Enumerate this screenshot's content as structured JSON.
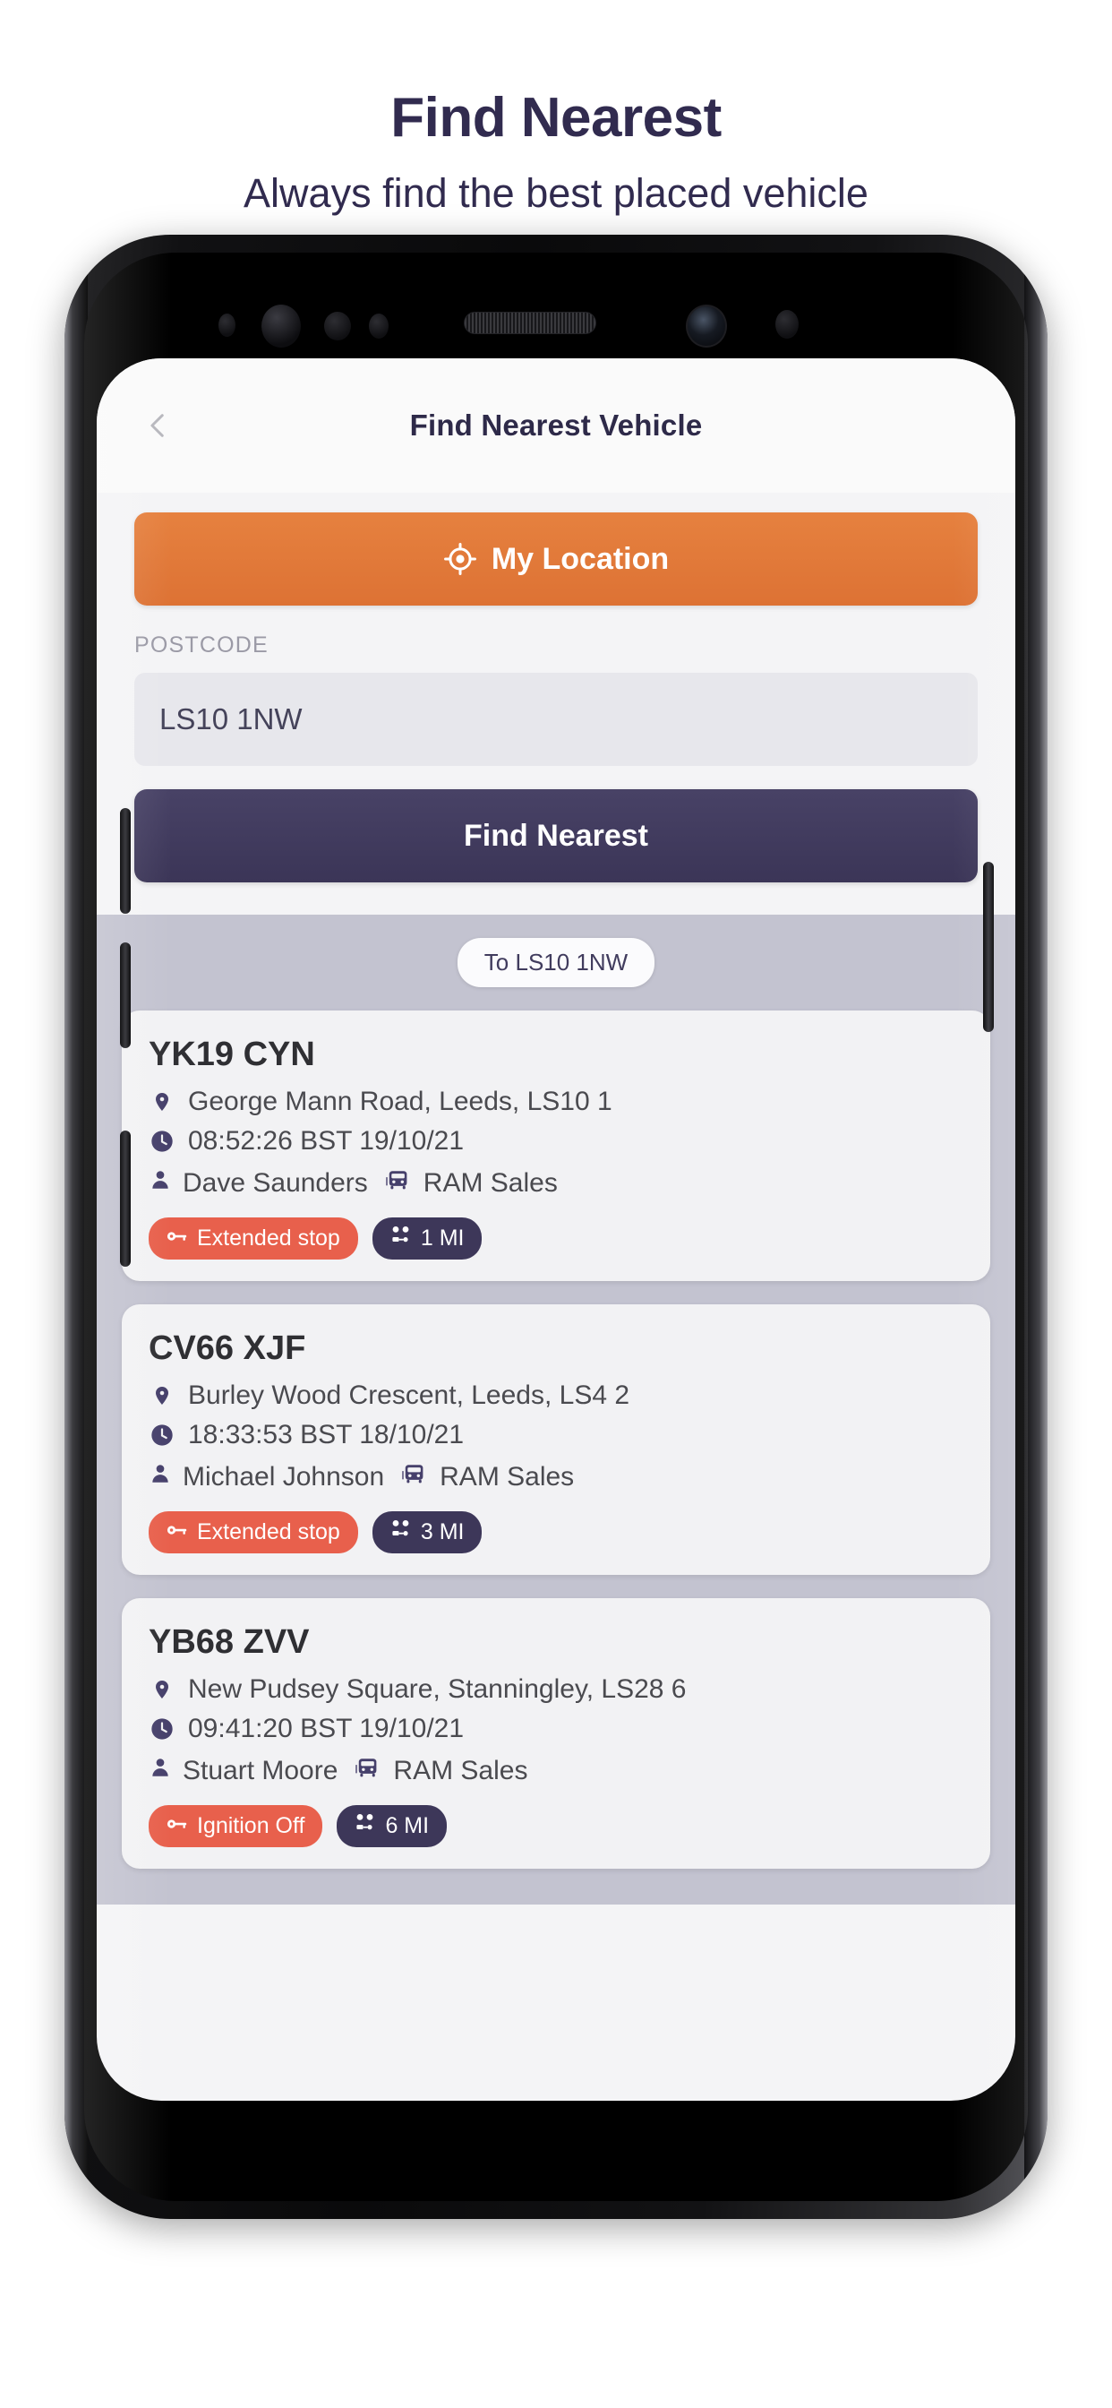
{
  "promo": {
    "title": "Find Nearest",
    "subtitle": "Always find the best placed vehicle"
  },
  "colors": {
    "brand_navy": "#3d3759",
    "brand_orange": "#e0763a",
    "status_red": "#e8604c",
    "screen_bg": "#f4f4f6",
    "results_bg": "#c3c3d0",
    "card_bg": "#f2f2f4"
  },
  "app": {
    "header": {
      "title": "Find Nearest Vehicle",
      "back_icon": "chevron-left-icon"
    },
    "search": {
      "my_location_label": "My Location",
      "my_location_icon": "crosshair-icon",
      "postcode_label": "POSTCODE",
      "postcode_value": "LS10 1NW",
      "postcode_placeholder": "LS10 1NW",
      "find_label": "Find Nearest"
    },
    "results": {
      "to_chip": "To LS10 1NW",
      "cards": [
        {
          "reg": "YK19 CYN",
          "location_icon": "map-pin-icon",
          "location": "George Mann Road, Leeds, LS10 1",
          "time_icon": "clock-icon",
          "time": "08:52:26 BST 19/10/21",
          "driver_icon": "person-icon",
          "driver": "Dave Saunders",
          "vehicle_icon": "car-icon",
          "fleet": "RAM Sales",
          "status_icon": "key-icon",
          "status": "Extended stop",
          "distance_icon": "route-icon",
          "distance": "1 MI"
        },
        {
          "reg": "CV66 XJF",
          "location_icon": "map-pin-icon",
          "location": "Burley Wood Crescent, Leeds, LS4 2",
          "time_icon": "clock-icon",
          "time": "18:33:53 BST 18/10/21",
          "driver_icon": "person-icon",
          "driver": "Michael Johnson",
          "vehicle_icon": "car-icon",
          "fleet": "RAM Sales",
          "status_icon": "key-icon",
          "status": "Extended stop",
          "distance_icon": "route-icon",
          "distance": "3 MI"
        },
        {
          "reg": "YB68 ZVV",
          "location_icon": "map-pin-icon",
          "location": "New Pudsey Square, Stanningley, LS28 6",
          "time_icon": "clock-icon",
          "time": "09:41:20 BST 19/10/21",
          "driver_icon": "person-icon",
          "driver": "Stuart Moore",
          "vehicle_icon": "car-icon",
          "fleet": "RAM Sales",
          "status_icon": "key-icon",
          "status": "Ignition Off",
          "distance_icon": "route-icon",
          "distance": "6 MI"
        }
      ]
    }
  }
}
